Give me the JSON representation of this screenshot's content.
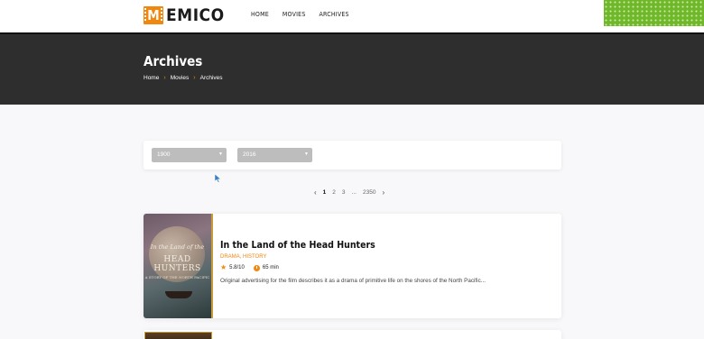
{
  "header": {
    "logo_letter": "M",
    "logo_text": "EMICO",
    "nav": [
      "HOME",
      "MOVIES",
      "ARCHIVES"
    ]
  },
  "banner": {
    "title": "Archives",
    "breadcrumb": [
      "Home",
      "Movies",
      "Archives"
    ]
  },
  "filters": {
    "year_from": "1900",
    "year_to": "2016"
  },
  "pagination": {
    "pages": [
      "1",
      "2",
      "3",
      "...",
      "2350"
    ],
    "active": "1"
  },
  "movies": [
    {
      "title": "In the Land of the Head Hunters",
      "genres": "DRAMA, HISTORY",
      "rating": "5.8/10",
      "duration": "65 min",
      "description": "Original advertising for the film describes it as a drama of primitive life on the shores of the North Pacific...",
      "poster": {
        "line1": "In the Land of the",
        "line2a": "HEAD",
        "line2b": "HUNTERS",
        "line3": "A STORY OF THE NORTH PACIFIC"
      }
    }
  ],
  "colors": {
    "accent": "#f0870f",
    "banner": "#2e2e2e",
    "select": "#bdbdbd"
  },
  "icons": {
    "star": "star-icon",
    "clock": "clock-icon",
    "prev": "chevron-left-icon",
    "next": "chevron-right-icon",
    "cursor": "mouse-cursor-icon"
  }
}
